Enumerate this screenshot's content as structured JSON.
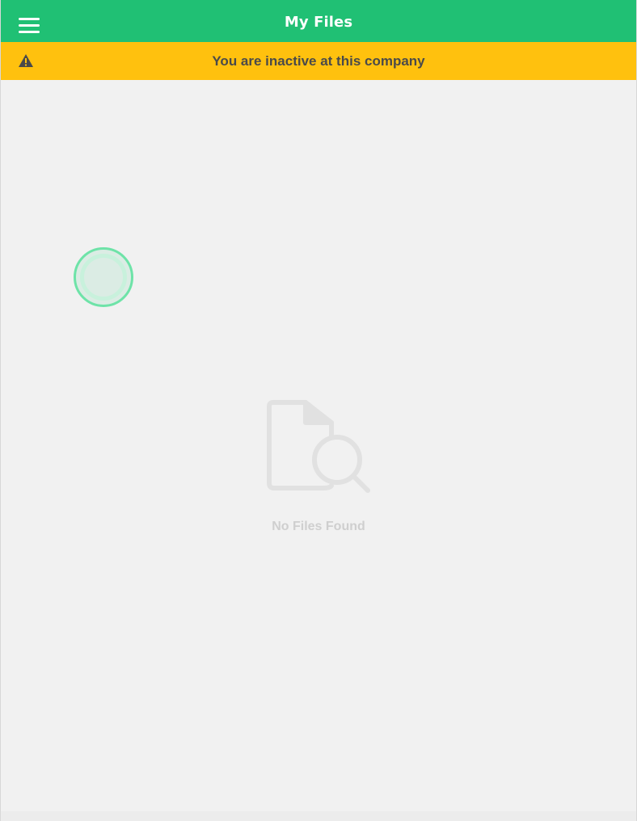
{
  "header": {
    "title": "My Files",
    "menu_icon": "hamburger-menu-icon",
    "background": "#20c074"
  },
  "banner": {
    "icon": "warning-triangle-icon",
    "message": "You are inactive at this company",
    "background": "#ffc10e"
  },
  "loading_indicator": {
    "icon": "loading-ring-icon",
    "color": "#6ee3a8"
  },
  "empty_state": {
    "icon": "file-search-icon",
    "message": "No Files Found"
  }
}
